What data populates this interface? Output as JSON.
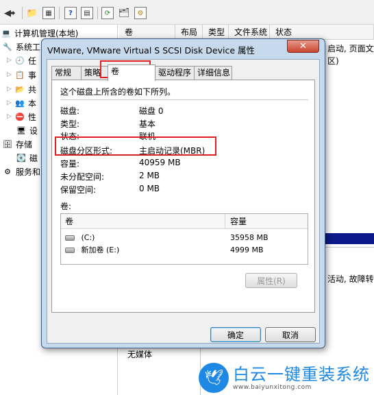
{
  "background": {
    "tree_items": [
      {
        "label": "计算机管理(本地)"
      },
      {
        "label": "系统工"
      },
      {
        "label": "任"
      },
      {
        "label": "事"
      },
      {
        "label": "共"
      },
      {
        "label": "本"
      },
      {
        "label": "性"
      },
      {
        "label": "设"
      },
      {
        "label": "存储"
      },
      {
        "label": "磁"
      },
      {
        "label": "服务和"
      }
    ],
    "list_columns": [
      "卷",
      "布局",
      "类型",
      "文件系统",
      "状态"
    ],
    "right_text_1": "启动, 页面文",
    "right_text_2": "区)",
    "right_text_3": "活动, 故障转",
    "bottom_text": "无媒体"
  },
  "watermark": {
    "title": "白云一键重装系统",
    "url": "www.baiyunxitong.com"
  },
  "dialog": {
    "title": "VMware, VMware Virtual S SCSI Disk Device 属性",
    "close_glyph": "✕",
    "tabs": [
      "常规",
      "策略",
      "卷",
      "驱动程序",
      "详细信息"
    ],
    "intro": "这个磁盘上所含的卷如下所列。",
    "props": [
      {
        "label": "磁盘:",
        "value": "磁盘 0"
      },
      {
        "label": "类型:",
        "value": "基本"
      },
      {
        "label": "状态:",
        "value": "联机"
      },
      {
        "label": "磁盘分区形式:",
        "value": "主启动记录(MBR)"
      },
      {
        "label": "容量:",
        "value": "40959 MB"
      },
      {
        "label": "未分配空间:",
        "value": "2 MB"
      },
      {
        "label": "保留空间:",
        "value": "0 MB"
      }
    ],
    "volumes_label": "卷:",
    "volumes_columns": [
      "卷",
      "容量"
    ],
    "volumes": [
      {
        "name": "(C:)",
        "capacity": "35958 MB"
      },
      {
        "name": "新加卷 (E:)",
        "capacity": "4999 MB"
      }
    ],
    "properties_button": "属性(R)",
    "ok_button": "确定",
    "cancel_button": "取消"
  }
}
